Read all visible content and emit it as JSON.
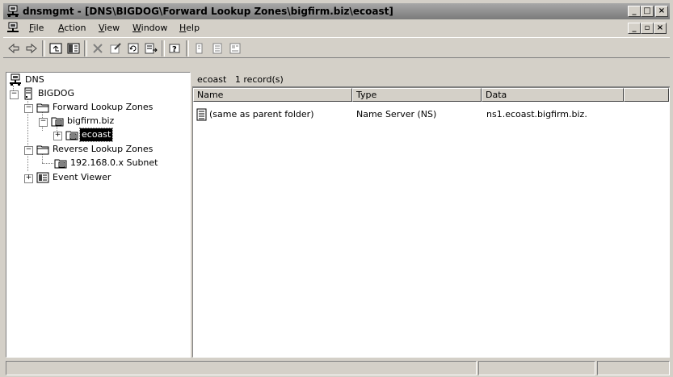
{
  "window": {
    "title": "dnsmgmt - [DNS\\BIGDOG\\Forward Lookup Zones\\bigfirm.biz\\ecoast]",
    "controls": [
      "_",
      "□",
      "×"
    ]
  },
  "menubar": {
    "items": [
      {
        "label": "File",
        "accel": "F"
      },
      {
        "label": "Action",
        "accel": "A"
      },
      {
        "label": "View",
        "accel": "V"
      },
      {
        "label": "Window",
        "accel": "W"
      },
      {
        "label": "Help",
        "accel": "H"
      }
    ],
    "doc_controls": [
      "_",
      "▫",
      "×"
    ]
  },
  "toolbar": {
    "buttons": [
      "back-arrow",
      "forward-arrow",
      "up-folder",
      "show-hide-tree",
      "delete",
      "properties",
      "refresh",
      "export-list",
      "help",
      "new-record-1",
      "new-record-2",
      "new-record-3"
    ]
  },
  "tree": {
    "nodes": [
      {
        "label": "DNS",
        "icon": "dns-icon"
      },
      {
        "label": "BIGDOG",
        "icon": "server-icon",
        "expander": "−"
      },
      {
        "label": "Forward Lookup Zones",
        "icon": "folder-icon",
        "expander": "−"
      },
      {
        "label": "bigfirm.biz",
        "icon": "zone-icon",
        "expander": "−"
      },
      {
        "label": "ecoast",
        "icon": "zone-icon",
        "expander": "+",
        "selected": true
      },
      {
        "label": "Reverse Lookup Zones",
        "icon": "folder-icon",
        "expander": "−"
      },
      {
        "label": "192.168.0.x Subnet",
        "icon": "zone-icon"
      },
      {
        "label": "Event Viewer",
        "icon": "event-viewer-icon",
        "expander": "+"
      }
    ]
  },
  "list": {
    "caption": "ecoast   1 record(s)",
    "columns": [
      "Name",
      "Type",
      "Data"
    ],
    "rows": [
      {
        "name": "(same as parent folder)",
        "type": "Name Server (NS)",
        "data": "ns1.ecoast.bigfirm.biz."
      }
    ]
  }
}
